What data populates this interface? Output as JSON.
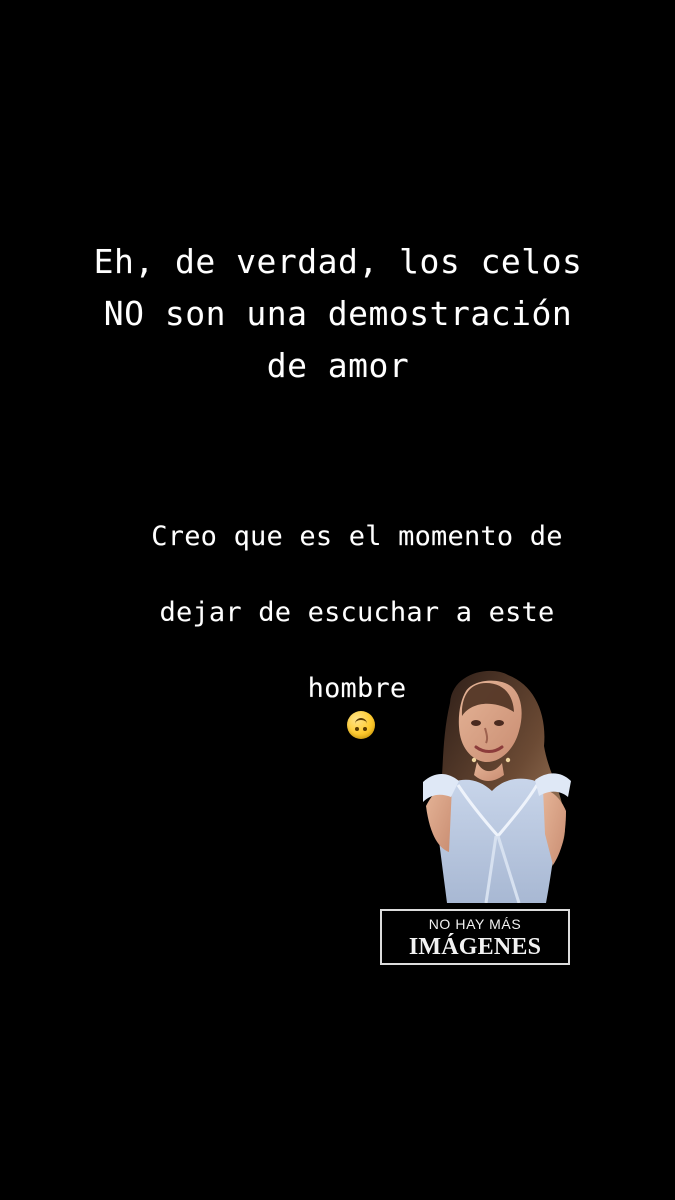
{
  "story": {
    "headline": "Eh, de verdad, los celos\nNO son una demostración\nde amor",
    "subtext_line1": "Creo que es el momento de",
    "subtext_line2": "dejar de escuchar a este",
    "subtext_line3": "hombre",
    "emoji_name": "upside-down-face-icon"
  },
  "sticker": {
    "caption_small": "NO HAY MÁS",
    "caption_large": "IMÁGENES",
    "figure_icon": "woman-sticker-image"
  },
  "colors": {
    "background": "#000000",
    "text": "#ffffff",
    "caption_border": "#dcdcdc"
  }
}
